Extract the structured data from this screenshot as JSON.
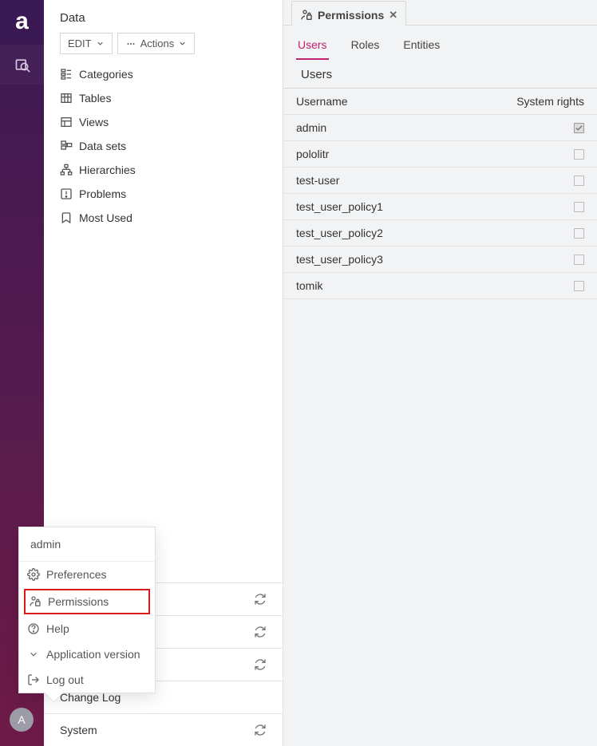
{
  "rail": {
    "logo_letter": "a",
    "avatar_letter": "A"
  },
  "sidebar": {
    "title_data": "Data",
    "edit_label": "EDIT",
    "actions_label": "Actions",
    "items": [
      {
        "label": "Categories"
      },
      {
        "label": "Tables"
      },
      {
        "label": "Views"
      },
      {
        "label": "Data sets"
      },
      {
        "label": "Hierarchies"
      },
      {
        "label": "Problems"
      },
      {
        "label": "Most Used"
      }
    ],
    "bottom_sections": [
      {
        "label": "Change Log",
        "refresh": false
      },
      {
        "label": "System",
        "refresh": true
      }
    ],
    "hidden_refresh_rows": 3
  },
  "popover": {
    "username": "admin",
    "items": [
      {
        "label": "Preferences",
        "icon": "gear"
      },
      {
        "label": "Permissions",
        "icon": "permissions",
        "highlight": true
      },
      {
        "label": "Help",
        "icon": "help"
      },
      {
        "label": "Application version",
        "icon": "chevron-down"
      },
      {
        "label": "Log out",
        "icon": "logout"
      }
    ]
  },
  "main": {
    "window_tab_label": "Permissions",
    "inner_tabs": [
      {
        "label": "Users",
        "active": true
      },
      {
        "label": "Roles",
        "active": false
      },
      {
        "label": "Entities",
        "active": false
      }
    ],
    "panel_title": "Users",
    "columns": {
      "username": "Username",
      "rights": "System rights"
    },
    "rows": [
      {
        "username": "admin",
        "system_rights": true,
        "locked": true
      },
      {
        "username": "pololitr",
        "system_rights": false
      },
      {
        "username": "test-user",
        "system_rights": false
      },
      {
        "username": "test_user_policy1",
        "system_rights": false
      },
      {
        "username": "test_user_policy2",
        "system_rights": false
      },
      {
        "username": "test_user_policy3",
        "system_rights": false
      },
      {
        "username": "tomik",
        "system_rights": false
      }
    ]
  }
}
